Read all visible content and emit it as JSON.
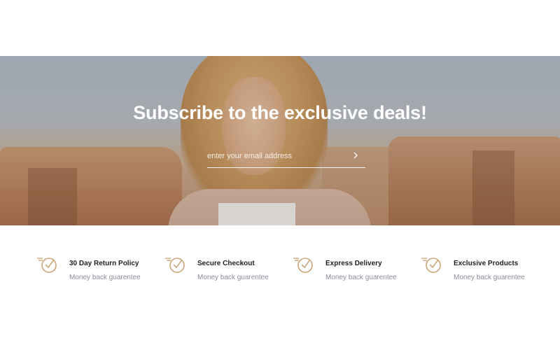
{
  "hero": {
    "title": "Subscribe to the exclusive deals!",
    "email_placeholder": "enter your email address",
    "submit_icon": "chevron-right-icon"
  },
  "features": [
    {
      "icon": "clock-check-icon",
      "title": "30 Day Return Policy",
      "subtitle": "Money back guarentee"
    },
    {
      "icon": "clock-check-icon",
      "title": "Secure Checkout",
      "subtitle": "Money back guarentee"
    },
    {
      "icon": "clock-check-icon",
      "title": "Express Delivery",
      "subtitle": "Money back guarentee"
    },
    {
      "icon": "clock-check-icon",
      "title": "Exclusive Products",
      "subtitle": "Money back guarentee"
    }
  ],
  "colors": {
    "icon": "#c9a77a",
    "title": "#222222",
    "subtitle": "#8a8d9a"
  }
}
